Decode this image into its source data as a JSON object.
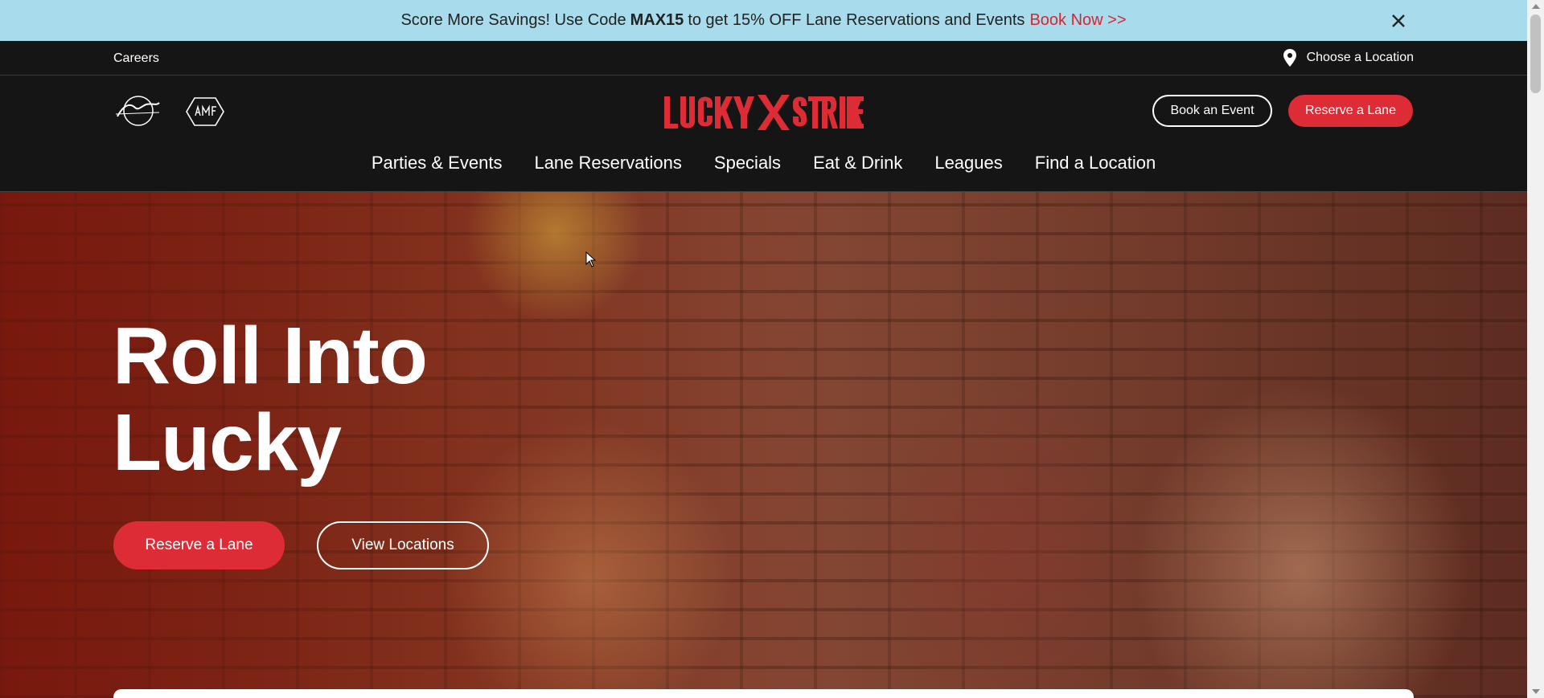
{
  "promo": {
    "text_pre": "Score More Savings! Use Code",
    "code": "MAX15",
    "text_post": "to get 15% OFF Lane Reservations and Events",
    "link": "Book Now >>",
    "close_icon": "close-icon"
  },
  "utility": {
    "careers": "Careers",
    "choose_location": "Choose a Location",
    "location_icon": "map-pin-icon"
  },
  "header": {
    "brands": [
      "Bowlero",
      "AMF"
    ],
    "logo_text": "LUCKY STRIKE",
    "book_event": "Book an Event",
    "reserve_lane": "Reserve a Lane",
    "nav": [
      "Parties & Events",
      "Lane Reservations",
      "Specials",
      "Eat & Drink",
      "Leagues",
      "Find a Location"
    ]
  },
  "hero": {
    "title_line1": "Roll Into",
    "title_line2": "Lucky",
    "reserve_lane": "Reserve a Lane",
    "view_locations": "View Locations"
  },
  "colors": {
    "accent_red": "#dd2c35",
    "promo_bg": "#a8dcec",
    "header_bg": "#151515"
  }
}
